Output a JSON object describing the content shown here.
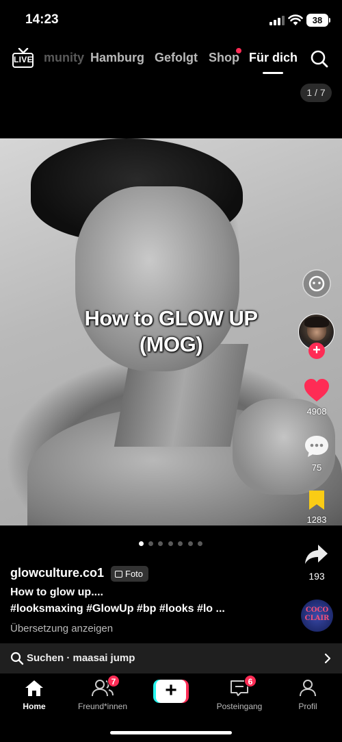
{
  "status_bar": {
    "time": "14:23",
    "battery": "38"
  },
  "top_nav": {
    "live_label": "LIVE",
    "tabs": [
      {
        "label": "munity"
      },
      {
        "label": "Hamburg"
      },
      {
        "label": "Gefolgt"
      },
      {
        "label": "Shop"
      },
      {
        "label": "Für dich"
      }
    ],
    "active_tab": "Für dich"
  },
  "page_counter": "1 / 7",
  "post": {
    "overlay_title": "How to GLOW UP\n(MOG)",
    "slide_count": 7,
    "active_slide": 1
  },
  "rail": {
    "likes": "4908",
    "comments": "75",
    "saves": "1283",
    "shares": "193"
  },
  "caption": {
    "username": "glowculture.co1",
    "badge": "Foto",
    "title": "How to glow up....",
    "hashtags": "#looksmaxing #GlowUp #bp #looks #lo ...",
    "translate": "Übersetzung anzeigen"
  },
  "music_disc_text": "COCO CLAIR",
  "search_bar": {
    "text": "Suchen · maasai jump"
  },
  "bottom_nav": {
    "home": "Home",
    "friends": "Freund*innen",
    "friends_badge": "7",
    "inbox": "Posteingang",
    "inbox_badge": "6",
    "profile": "Profil",
    "create": "+"
  },
  "colors": {
    "accent": "#fe2c55",
    "cyan": "#25f4ee",
    "bookmark": "#facc15"
  }
}
